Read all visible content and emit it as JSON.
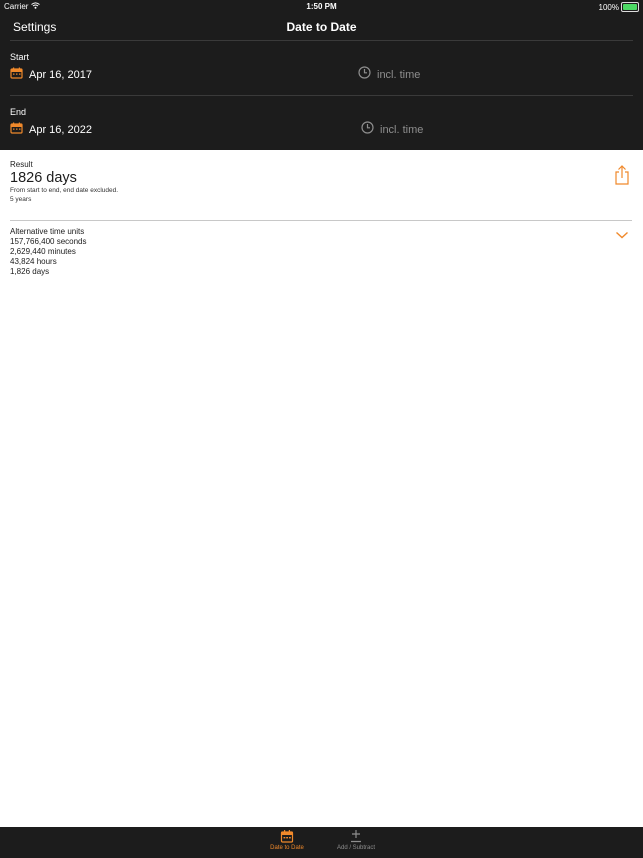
{
  "status_bar": {
    "carrier": "Carrier",
    "time": "1:50 PM",
    "battery": "100%"
  },
  "nav": {
    "settings": "Settings",
    "title": "Date to Date"
  },
  "start": {
    "label": "Start",
    "date": "Apr 16, 2017",
    "time_option": "incl. time"
  },
  "end": {
    "label": "End",
    "date": "Apr 16, 2022",
    "time_option": "incl. time"
  },
  "result": {
    "label": "Result",
    "value": "1826 days",
    "note": "From start to end, end date excluded.",
    "years": "5 years"
  },
  "alternative": {
    "title": "Alternative time units",
    "seconds": "157,766,400 seconds",
    "minutes": "2,629,440 minutes",
    "hours": "43,824 hours",
    "days": "1,826 days"
  },
  "tabs": [
    {
      "label": "Date to Date",
      "icon": "calendar-icon"
    },
    {
      "label": "Add / Subtract",
      "icon": "plus-minus-icon"
    }
  ],
  "colors": {
    "accent": "#f0892b",
    "dark_bg": "#1c1c1c",
    "muted": "#8e8e8e",
    "battery": "#4cd964"
  }
}
